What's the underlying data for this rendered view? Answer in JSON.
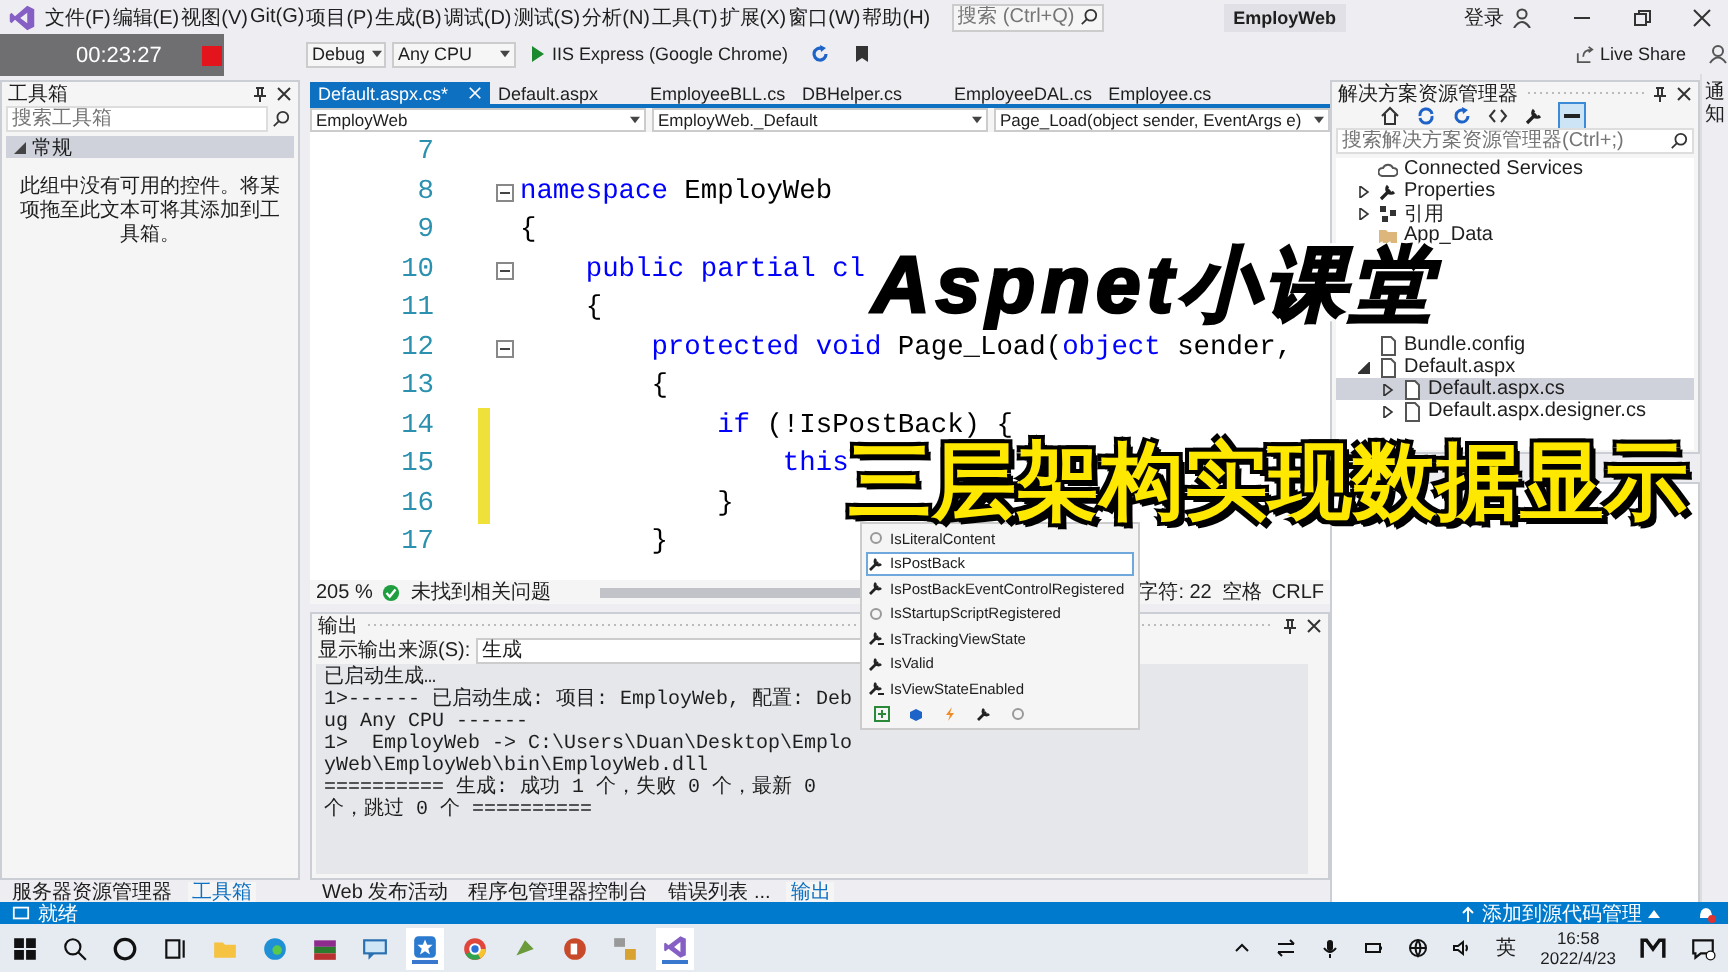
{
  "menu": {
    "items": [
      "文件(F)",
      "编辑(E)",
      "视图(V)",
      "Git(G)",
      "项目(P)",
      "生成(B)",
      "调试(D)",
      "测试(S)",
      "分析(N)",
      "工具(T)",
      "扩展(X)",
      "窗口(W)",
      "帮助(H)"
    ],
    "search": {
      "placeholder": "搜索 (Ctrl+Q)"
    },
    "solution_name": "EmployWeb",
    "login": "登录"
  },
  "toolbar": {
    "configuration": "Debug",
    "platform": "Any CPU",
    "run_target": "IIS Express (Google Chrome)",
    "live_share": "Live Share"
  },
  "recording_timer": "00:23:27",
  "toolbox": {
    "title": "工具箱",
    "search": {
      "placeholder": "搜索工具箱"
    },
    "group": "常规",
    "expanded": true,
    "empty_message": "此组中没有可用的控件。将某项拖至此文本可将其添加到工具箱。"
  },
  "editor": {
    "tabs": [
      {
        "label": "Default.aspx.cs*",
        "selected": true
      },
      {
        "label": "Default.aspx",
        "selected": false
      },
      {
        "label": "EmployeeBLL.cs",
        "selected": false
      },
      {
        "label": "DBHelper.cs",
        "selected": false
      },
      {
        "label": "EmployeeDAL.cs",
        "selected": false
      },
      {
        "label": "Employee.cs",
        "selected": false
      }
    ],
    "nav": [
      "EmployWeb",
      "EmployWeb._Default",
      "Page_Load(object sender, EventArgs e)"
    ],
    "lines": [
      {
        "number": "7",
        "foldable": false,
        "changed": false
      },
      {
        "number": "8",
        "foldable": true,
        "changed": false,
        "tokens": [
          {
            "text": "namespace",
            "kind": "keyword"
          },
          {
            "text": " EmployWeb",
            "kind": "plain"
          }
        ]
      },
      {
        "number": "9",
        "foldable": false,
        "changed": false,
        "tokens": [
          {
            "text": "{",
            "kind": "plain"
          }
        ]
      },
      {
        "number": "10",
        "foldable": true,
        "changed": false,
        "tokens": [
          {
            "text": "    public partial cl",
            "kind": "keyword"
          }
        ]
      },
      {
        "number": "11",
        "foldable": false,
        "changed": false,
        "tokens": [
          {
            "text": "    {",
            "kind": "plain"
          }
        ]
      },
      {
        "number": "12",
        "foldable": true,
        "changed": false,
        "tokens": [
          {
            "text": "        protected void",
            "kind": "keyword"
          },
          {
            "text": " Page_Load(",
            "kind": "plain"
          },
          {
            "text": "object",
            "kind": "keyword"
          },
          {
            "text": " sender,",
            "kind": "plain"
          }
        ]
      },
      {
        "number": "13",
        "foldable": false,
        "changed": false,
        "tokens": [
          {
            "text": "        {",
            "kind": "plain"
          }
        ]
      },
      {
        "number": "14",
        "foldable": false,
        "changed": true,
        "tokens": [
          {
            "text": "            if",
            "kind": "keyword"
          },
          {
            "text": " (!IsPostBack) {",
            "kind": "plain"
          }
        ]
      },
      {
        "number": "15",
        "foldable": false,
        "changed": true,
        "tokens": [
          {
            "text": "                this",
            "kind": "keyword"
          }
        ]
      },
      {
        "number": "16",
        "foldable": false,
        "changed": true,
        "tokens": [
          {
            "text": "            }",
            "kind": "plain"
          }
        ]
      },
      {
        "number": "17",
        "foldable": false,
        "changed": false,
        "tokens": [
          {
            "text": "        }",
            "kind": "plain"
          }
        ]
      }
    ],
    "status": {
      "zoom": "205 %",
      "issues": "未找到相关问题",
      "column": "字符: 22",
      "indent": "空格",
      "line_ending": "CRLF"
    }
  },
  "autocomplete": [
    {
      "label": "IsLiteralContent",
      "kind": "method",
      "selected": false
    },
    {
      "label": "IsPostBack",
      "kind": "property",
      "selected": true
    },
    {
      "label": "IsPostBackEventControlRegistered",
      "kind": "property",
      "selected": false
    },
    {
      "label": "IsStartupScriptRegistered",
      "kind": "method",
      "selected": false
    },
    {
      "label": "IsTrackingViewState",
      "kind": "protected",
      "selected": false
    },
    {
      "label": "IsValid",
      "kind": "property",
      "selected": false
    },
    {
      "label": "IsViewStateEnabled",
      "kind": "protected",
      "selected": false
    }
  ],
  "output": {
    "title": "输出",
    "source_label": "显示输出来源(S):",
    "source": "生成",
    "lines": [
      "已启动生成…",
      "1>------ 已启动生成: 项目: EmployWeb, 配置: Debug Any CPU ------",
      "1>  EmployWeb -> C:\\Users\\Duan\\Desktop\\EmployWeb\\EmployWeb\\bin\\EmployWeb.dll",
      "========== 生成: 成功 1 个，失败 0 个，最新 0 个，跳过 0 个 =========="
    ]
  },
  "left_tabs": [
    {
      "label": "服务器资源管理器",
      "selected": false
    },
    {
      "label": "工具箱",
      "selected": true
    }
  ],
  "bottom_tabs": [
    {
      "label": "Web 发布活动",
      "selected": false
    },
    {
      "label": "程序包管理器控制台",
      "selected": false
    },
    {
      "label": "错误列表 ...",
      "selected": false
    },
    {
      "label": "输出",
      "selected": true
    }
  ],
  "solution_explorer": {
    "title": "解决方案资源管理器",
    "search": {
      "placeholder": "搜索解决方案资源管理器(Ctrl+;)"
    },
    "items": [
      {
        "label": "Connected Services",
        "kind": "cloud"
      },
      {
        "label": "Properties",
        "kind": "wrench",
        "expanded": false
      },
      {
        "label": "引用",
        "kind": "references",
        "expanded": false
      },
      {
        "label": "App_Data",
        "kind": "folder"
      },
      {
        "label": "Bundle.config",
        "kind": "file"
      },
      {
        "label": "Default.aspx",
        "kind": "file",
        "expanded": true,
        "selected": false,
        "children": [
          {
            "label": "Default.aspx.cs",
            "kind": "file",
            "expanded": false,
            "selected": true
          },
          {
            "label": "Default.aspx.designer.cs",
            "kind": "file",
            "expanded": false,
            "selected": false
          }
        ]
      }
    ]
  },
  "notifications": "通知",
  "status_bar": {
    "state": "就绪",
    "source_control": "添加到源代码管理"
  },
  "taskbar": {
    "ime": "英",
    "time": "16:58",
    "date": "2022/4/23"
  },
  "captions": [
    "Aspnet小课堂",
    "三层架构实现数据显示"
  ]
}
